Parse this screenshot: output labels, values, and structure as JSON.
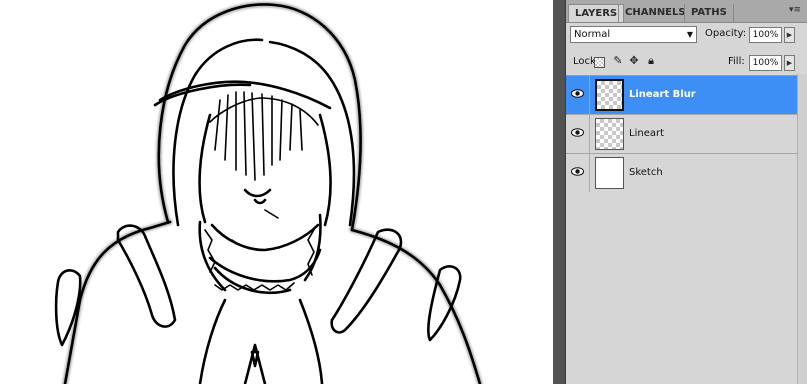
{
  "panel": {
    "tabs": [
      {
        "label": "LAYERS",
        "active": true
      },
      {
        "label": "CHANNELS",
        "active": false
      },
      {
        "label": "PATHS",
        "active": false
      }
    ],
    "menu_icon": "panel-menu-icon",
    "blend_mode": "Normal",
    "opacity_label": "Opacity:",
    "opacity_value": "100%",
    "lock_label": "Lock:",
    "fill_label": "Fill:",
    "fill_value": "100%",
    "layers": [
      {
        "name": "Lineart Blur",
        "visible": true,
        "selected": true,
        "thumbnail": "transparent"
      },
      {
        "name": "Lineart",
        "visible": true,
        "selected": false,
        "thumbnail": "transparent"
      },
      {
        "name": "Sketch",
        "visible": true,
        "selected": false,
        "thumbnail": "white"
      }
    ]
  },
  "colors": {
    "selection": "#3d8ff5",
    "panel_bg": "#d6d6d6",
    "tab_bar": "#a9a9a9"
  }
}
